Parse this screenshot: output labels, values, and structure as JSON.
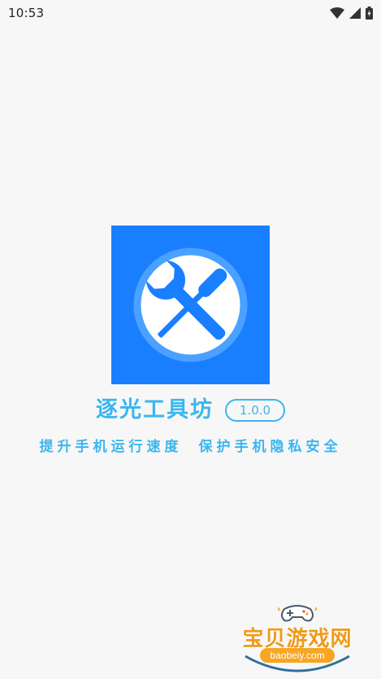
{
  "status_bar": {
    "time": "10:53",
    "icons": [
      "wifi-icon",
      "signal-icon",
      "battery-icon"
    ]
  },
  "app": {
    "name": "逐光工具坊",
    "version": "1.0.0",
    "slogan_left": "提升手机运行速度",
    "slogan_right": "保护手机隐私安全",
    "icon": "wrench-screwdriver-icon"
  },
  "watermark": {
    "name": "宝贝游戏网",
    "url": "baobeiy.com"
  },
  "colors": {
    "background": "#f7f7f7",
    "accent": "#3ab6f0",
    "icon_blue": "#1a7fff",
    "watermark_orange": "#f09a1a"
  }
}
